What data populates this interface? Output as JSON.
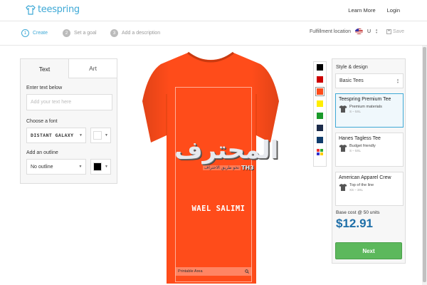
{
  "header": {
    "logo_text": "teespring",
    "links": {
      "learn_more": "Learn More",
      "login": "Login"
    }
  },
  "steps": [
    {
      "num": "1",
      "label": "Create",
      "active": true
    },
    {
      "num": "2",
      "label": "Set a goal",
      "active": false
    },
    {
      "num": "3",
      "label": "Add a description",
      "active": false
    }
  ],
  "fulfillment": {
    "label": "Fulfillment location",
    "value": "U",
    "save_label": "Save"
  },
  "left_panel": {
    "tabs": {
      "text": "Text",
      "art": "Art"
    },
    "enter_text_label": "Enter text below",
    "text_placeholder": "Add your text here",
    "font_label": "Choose a font",
    "font_value": "DISTANT GALAXY",
    "font_color": "#ffffff",
    "outline_label": "Add an outline",
    "outline_value": "No outline",
    "outline_color": "#000000"
  },
  "design": {
    "arabic_text": "المحترف",
    "tagline": "نحو طريق الاحتراف",
    "badge": "TH3",
    "name": "WAEL SALIMI",
    "printable_area_label": "Printable Area",
    "shirt_color": "#ff4c1a"
  },
  "palette": {
    "colors": [
      "#000000",
      "#cc0000",
      "#ff4c1a",
      "#ffee00",
      "#1a9a2a",
      "#1c2b4a",
      "#0f3b6b"
    ]
  },
  "right_panel": {
    "style_label": "Style & design",
    "style_value": "Basic Tees",
    "products": [
      {
        "name": "Teespring Premium Tee",
        "meta": "Premium materials",
        "sizes": "S – 5XL"
      },
      {
        "name": "Hanes Tagless Tee",
        "meta": "Budget friendly",
        "sizes": "S – 5XL"
      },
      {
        "name": "American Apparel Crew",
        "meta": "Top of the line",
        "sizes": "XS – 3XL"
      }
    ],
    "base_cost_label": "Base cost @ 50 units",
    "price": "$12.91",
    "next_label": "Next"
  }
}
